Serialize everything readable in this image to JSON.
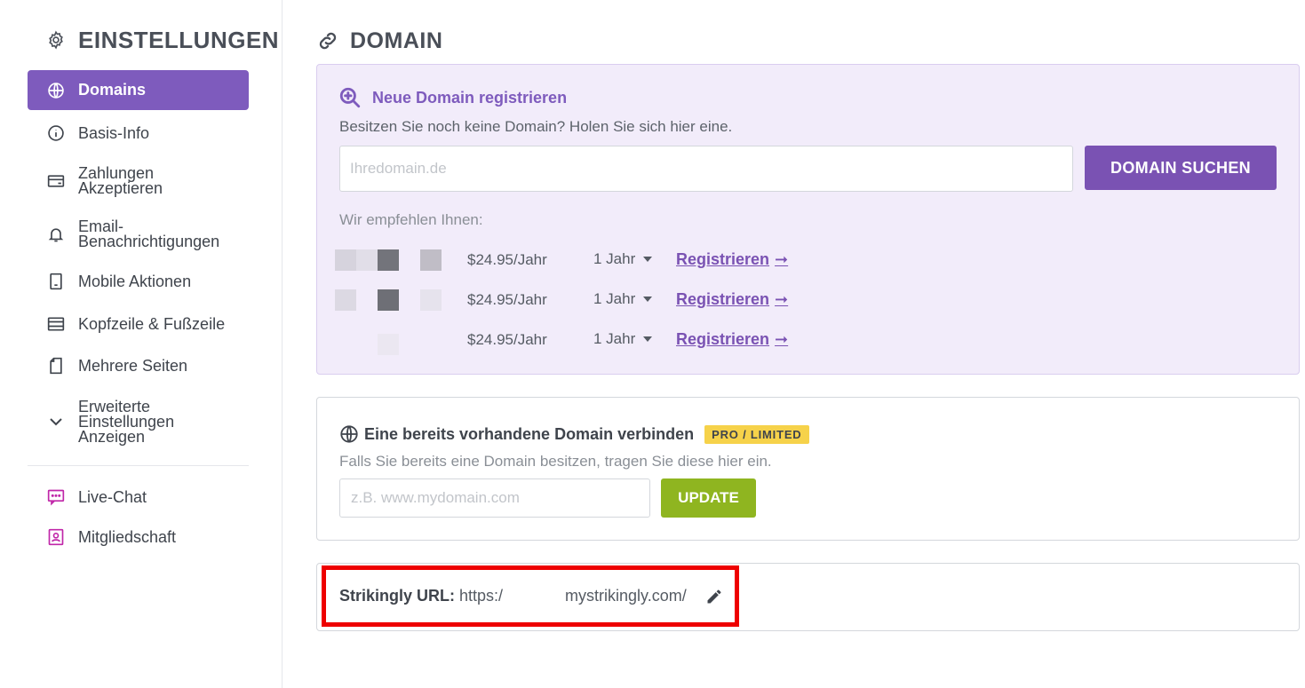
{
  "sidebar": {
    "title": "EINSTELLUNGEN",
    "items": [
      {
        "label": "Domains",
        "icon": "globe-icon"
      },
      {
        "label": "Basis-Info",
        "icon": "info-icon"
      },
      {
        "label": "Zahlungen Akzeptieren",
        "icon": "payment-card-icon"
      },
      {
        "label": "Email-Benachrichtigungen",
        "icon": "bell-icon"
      },
      {
        "label": "Mobile Aktionen",
        "icon": "mobile-icon"
      },
      {
        "label": "Kopfzeile & Fußzeile",
        "icon": "header-footer-icon"
      },
      {
        "label": "Mehrere Seiten",
        "icon": "pages-icon"
      },
      {
        "label": "Erweiterte Einstellungen Anzeigen",
        "icon": "chevron-down-icon"
      }
    ],
    "extra_items": [
      {
        "label": "Live-Chat",
        "icon": "chat-icon"
      },
      {
        "label": "Mitgliedschaft",
        "icon": "membership-icon"
      }
    ],
    "accent_color": "#7e5bbd",
    "pink_icon_color": "#c026a8"
  },
  "main": {
    "title": "DOMAIN",
    "register": {
      "title": "Neue Domain registrieren",
      "subtitle": "Besitzen Sie noch keine Domain? Holen Sie sich hier eine.",
      "input_placeholder": "Ihredomain.de",
      "button_label": "DOMAIN SUCHEN",
      "recommend_label": "Wir empfehlen Ihnen:",
      "suggestions": [
        {
          "price": "$24.95/Jahr",
          "years": "1 Jahr",
          "link": "Registrieren"
        },
        {
          "price": "$24.95/Jahr",
          "years": "1 Jahr",
          "link": "Registrieren"
        },
        {
          "price": "$24.95/Jahr",
          "years": "1 Jahr",
          "link": "Registrieren"
        }
      ]
    },
    "connect": {
      "title": "Eine bereits vorhandene Domain verbinden",
      "badge": "PRO / LIMITED",
      "subtitle": "Falls Sie bereits eine Domain besitzen, tragen Sie diese hier ein.",
      "input_placeholder": "z.B. www.mydomain.com",
      "button_label": "UPDATE"
    },
    "url": {
      "label": "Strikingly URL:",
      "prefix": "https:/",
      "suffix": "mystrikingly.com/"
    }
  }
}
